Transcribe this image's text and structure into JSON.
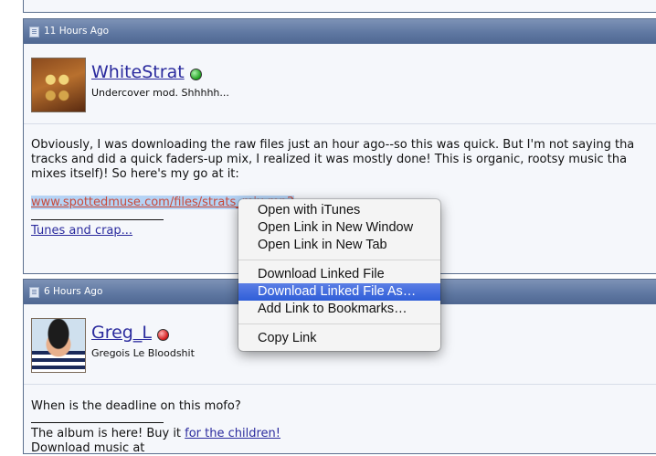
{
  "posts": [
    {
      "timestamp": "11 Hours Ago",
      "username": "WhiteStrat",
      "user_title": "Undercover mod. Shhhhh...",
      "body_lines": [
        "Obviously, I was downloading the raw files just an hour ago--so this was quick. But I'm not saying tha",
        "tracks and did a quick faders-up mix, I realized it was mostly done! This is organic, rootsy music tha",
        "mixes itself)! So here's my go at it:"
      ],
      "link": "www.spottedmuse.com/files/strats_mix.mp3",
      "signature_link": "Tunes and crap..."
    },
    {
      "timestamp": "6 Hours Ago",
      "username": "Greg_L",
      "user_title": "Gregois Le Bloodshit",
      "body_line_1": "When is the deadline on this mofo?",
      "signature_text": "The album is here! Buy it ",
      "signature_link": "for the children!",
      "cut_line": "Download music at"
    }
  ],
  "context_menu": {
    "group1": [
      "Open with iTunes",
      "Open Link in New Window",
      "Open Link in New Tab"
    ],
    "group2": [
      "Download Linked File",
      "Download Linked File As…",
      "Add Link to Bookmarks…"
    ],
    "group3": [
      "Copy Link"
    ],
    "highlighted": "Download Linked File As…"
  },
  "colors": {
    "header_bar": "#5f78a2",
    "link_blue": "#2b2b9e",
    "link_red": "#c84a3a",
    "menu_highlight": "#2f5ed8",
    "status_online": "#1ea01e",
    "status_offline": "#d01818"
  }
}
